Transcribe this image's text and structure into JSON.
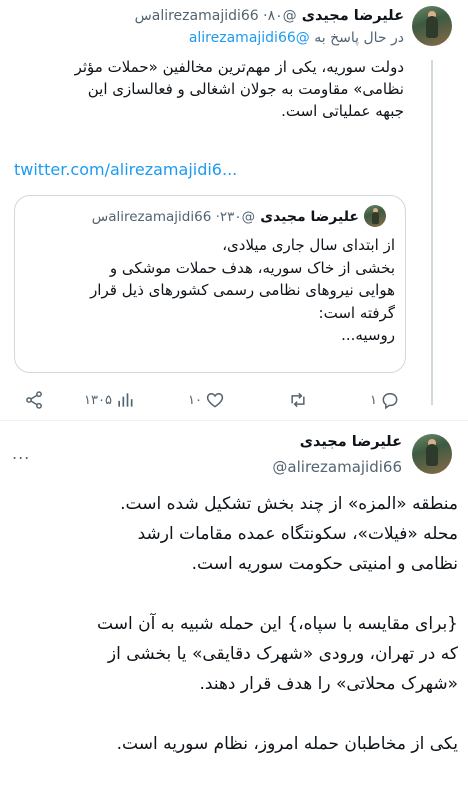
{
  "tweet1": {
    "author_name": "علیرضا مجیدی",
    "handle_time": "@alirezamajidi66 ·۸۰س",
    "reply_prefix": "در حال پاسخ به",
    "reply_handle": "@alirezamajidi66",
    "text_lines": [
      "دولت سوریه، یکی از مهم‌ترین مخالفین «حملات مؤثر",
      "نظامی» مقاومت به جولان اشغالی و فعالسازی این",
      "جبهه عملیاتی است."
    ],
    "link": "twitter.com/alirezamajidi6...",
    "more": "..."
  },
  "quoted": {
    "author_name": "علیرضا مجیدی",
    "handle_time": "@alirezamajidi66 ·۲۳۰س",
    "text_lines": [
      "از ابتدای سال جاری میلادی،",
      "بخشی از خاک سوریه، هدف حملات موشکی و",
      "هوایی نیروهای نظامی رسمی کشورهای ذیل قرار",
      "گرفته است:",
      "روسیه..."
    ]
  },
  "actions": {
    "reply_count": "۱",
    "retweet_count": "",
    "like_count": "۱۰",
    "views_count": "۱۳۰۵"
  },
  "tweet2": {
    "author_name": "علیرضا مجیدی",
    "handle": "@alirezamajidi66",
    "more": "...",
    "paragraphs": [
      [
        "منطقه «المزه» از چند بخش تشکیل شده است.",
        "محله «فیلات»، سکونتگاه عمده مقامات ارشد",
        "نظامی و امنیتی حکومت سوریه است."
      ],
      [
        "{برای مقایسه با سپاه،} این حمله شبیه به آن است",
        "که در تهران، ورودی «شهرک دقایقی» یا بخشی از",
        "«شهرک محلاتی» را هدف قرار دهند."
      ],
      [
        "یکی از مخاطبان حمله امروز، نظام سوریه است."
      ]
    ]
  }
}
